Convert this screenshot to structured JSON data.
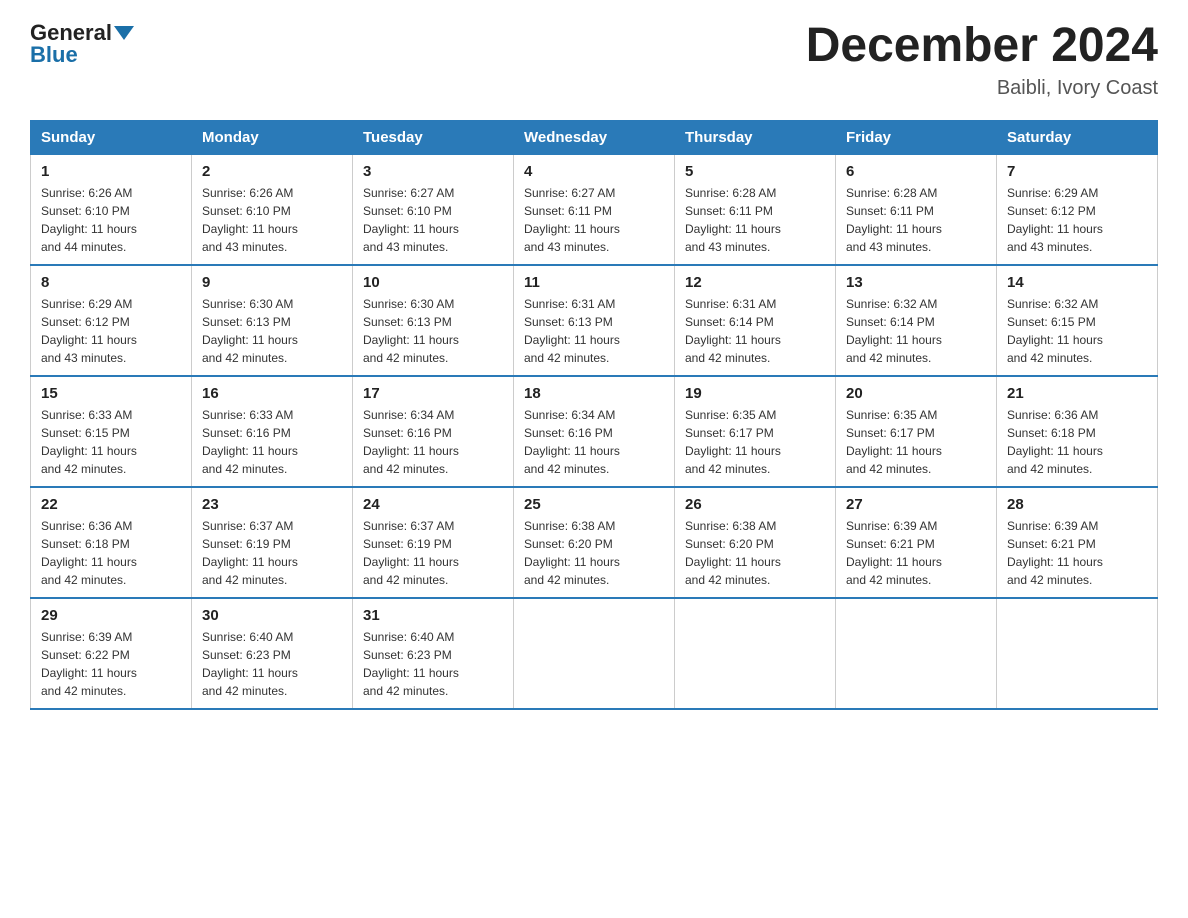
{
  "header": {
    "logo_general": "General",
    "logo_blue": "Blue",
    "month_title": "December 2024",
    "location": "Baibli, Ivory Coast"
  },
  "weekdays": [
    "Sunday",
    "Monday",
    "Tuesday",
    "Wednesday",
    "Thursday",
    "Friday",
    "Saturday"
  ],
  "weeks": [
    [
      {
        "day": "1",
        "sunrise": "6:26 AM",
        "sunset": "6:10 PM",
        "daylight": "11 hours and 44 minutes."
      },
      {
        "day": "2",
        "sunrise": "6:26 AM",
        "sunset": "6:10 PM",
        "daylight": "11 hours and 43 minutes."
      },
      {
        "day": "3",
        "sunrise": "6:27 AM",
        "sunset": "6:10 PM",
        "daylight": "11 hours and 43 minutes."
      },
      {
        "day": "4",
        "sunrise": "6:27 AM",
        "sunset": "6:11 PM",
        "daylight": "11 hours and 43 minutes."
      },
      {
        "day": "5",
        "sunrise": "6:28 AM",
        "sunset": "6:11 PM",
        "daylight": "11 hours and 43 minutes."
      },
      {
        "day": "6",
        "sunrise": "6:28 AM",
        "sunset": "6:11 PM",
        "daylight": "11 hours and 43 minutes."
      },
      {
        "day": "7",
        "sunrise": "6:29 AM",
        "sunset": "6:12 PM",
        "daylight": "11 hours and 43 minutes."
      }
    ],
    [
      {
        "day": "8",
        "sunrise": "6:29 AM",
        "sunset": "6:12 PM",
        "daylight": "11 hours and 43 minutes."
      },
      {
        "day": "9",
        "sunrise": "6:30 AM",
        "sunset": "6:13 PM",
        "daylight": "11 hours and 42 minutes."
      },
      {
        "day": "10",
        "sunrise": "6:30 AM",
        "sunset": "6:13 PM",
        "daylight": "11 hours and 42 minutes."
      },
      {
        "day": "11",
        "sunrise": "6:31 AM",
        "sunset": "6:13 PM",
        "daylight": "11 hours and 42 minutes."
      },
      {
        "day": "12",
        "sunrise": "6:31 AM",
        "sunset": "6:14 PM",
        "daylight": "11 hours and 42 minutes."
      },
      {
        "day": "13",
        "sunrise": "6:32 AM",
        "sunset": "6:14 PM",
        "daylight": "11 hours and 42 minutes."
      },
      {
        "day": "14",
        "sunrise": "6:32 AM",
        "sunset": "6:15 PM",
        "daylight": "11 hours and 42 minutes."
      }
    ],
    [
      {
        "day": "15",
        "sunrise": "6:33 AM",
        "sunset": "6:15 PM",
        "daylight": "11 hours and 42 minutes."
      },
      {
        "day": "16",
        "sunrise": "6:33 AM",
        "sunset": "6:16 PM",
        "daylight": "11 hours and 42 minutes."
      },
      {
        "day": "17",
        "sunrise": "6:34 AM",
        "sunset": "6:16 PM",
        "daylight": "11 hours and 42 minutes."
      },
      {
        "day": "18",
        "sunrise": "6:34 AM",
        "sunset": "6:16 PM",
        "daylight": "11 hours and 42 minutes."
      },
      {
        "day": "19",
        "sunrise": "6:35 AM",
        "sunset": "6:17 PM",
        "daylight": "11 hours and 42 minutes."
      },
      {
        "day": "20",
        "sunrise": "6:35 AM",
        "sunset": "6:17 PM",
        "daylight": "11 hours and 42 minutes."
      },
      {
        "day": "21",
        "sunrise": "6:36 AM",
        "sunset": "6:18 PM",
        "daylight": "11 hours and 42 minutes."
      }
    ],
    [
      {
        "day": "22",
        "sunrise": "6:36 AM",
        "sunset": "6:18 PM",
        "daylight": "11 hours and 42 minutes."
      },
      {
        "day": "23",
        "sunrise": "6:37 AM",
        "sunset": "6:19 PM",
        "daylight": "11 hours and 42 minutes."
      },
      {
        "day": "24",
        "sunrise": "6:37 AM",
        "sunset": "6:19 PM",
        "daylight": "11 hours and 42 minutes."
      },
      {
        "day": "25",
        "sunrise": "6:38 AM",
        "sunset": "6:20 PM",
        "daylight": "11 hours and 42 minutes."
      },
      {
        "day": "26",
        "sunrise": "6:38 AM",
        "sunset": "6:20 PM",
        "daylight": "11 hours and 42 minutes."
      },
      {
        "day": "27",
        "sunrise": "6:39 AM",
        "sunset": "6:21 PM",
        "daylight": "11 hours and 42 minutes."
      },
      {
        "day": "28",
        "sunrise": "6:39 AM",
        "sunset": "6:21 PM",
        "daylight": "11 hours and 42 minutes."
      }
    ],
    [
      {
        "day": "29",
        "sunrise": "6:39 AM",
        "sunset": "6:22 PM",
        "daylight": "11 hours and 42 minutes."
      },
      {
        "day": "30",
        "sunrise": "6:40 AM",
        "sunset": "6:23 PM",
        "daylight": "11 hours and 42 minutes."
      },
      {
        "day": "31",
        "sunrise": "6:40 AM",
        "sunset": "6:23 PM",
        "daylight": "11 hours and 42 minutes."
      },
      null,
      null,
      null,
      null
    ]
  ],
  "labels": {
    "sunrise": "Sunrise:",
    "sunset": "Sunset:",
    "daylight": "Daylight:"
  }
}
